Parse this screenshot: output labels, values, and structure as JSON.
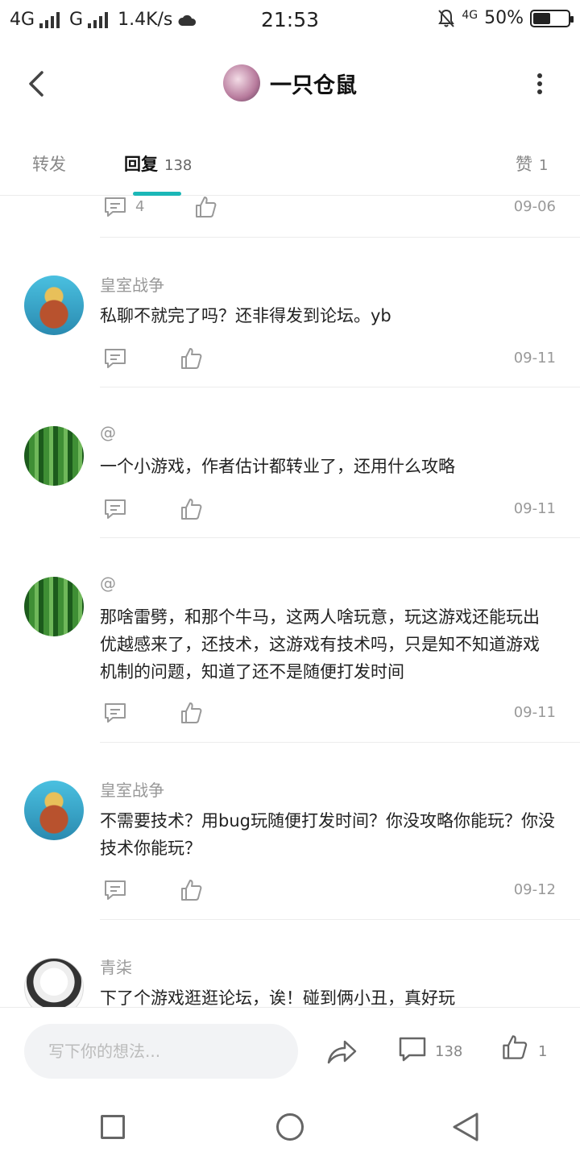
{
  "status_bar": {
    "network1": "4G",
    "network2": "G",
    "speed": "1.4K/s",
    "time": "21:53",
    "network3": "4G",
    "battery_text": "50%",
    "battery_level": 0.5
  },
  "header": {
    "title": "一只仓鼠"
  },
  "tabs": [
    {
      "label": "转发",
      "count": ""
    },
    {
      "label": "回复",
      "count": "138"
    },
    {
      "label": "赞",
      "count": "1"
    }
  ],
  "partial_item": {
    "comment_count": "4",
    "date": "09-06"
  },
  "replies": [
    {
      "name": "皇室战争",
      "avatar": "king",
      "text": "私聊不就完了吗？还非得发到论坛。yb",
      "date": "09-11"
    },
    {
      "name": "@",
      "avatar": "forest",
      "text": "一个小游戏，作者估计都转业了，还用什么攻略",
      "date": "09-11"
    },
    {
      "name": "@",
      "avatar": "forest",
      "text": "那啥雷劈，和那个牛马，这两人啥玩意，玩这游戏还能玩出优越感来了，还技术，这游戏有技术吗，只是知不知道游戏机制的问题，知道了还不是随便打发时间",
      "date": "09-11"
    },
    {
      "name": "皇室战争",
      "avatar": "king",
      "text": "不需要技术？用bug玩随便打发时间？你没攻略你能玩？你没技术你能玩？",
      "date": "09-12"
    },
    {
      "name": "青柒",
      "avatar": "anime",
      "text": "下了个游戏逛逛论坛，诶！碰到俩小丑，真好玩",
      "date": ""
    }
  ],
  "bottom_bar": {
    "input_placeholder": "写下你的想法...",
    "comment_count": "138",
    "like_count": "1"
  },
  "colors": {
    "accent": "#1bb7b7",
    "muted_text": "#999999",
    "divider": "#ececec"
  }
}
